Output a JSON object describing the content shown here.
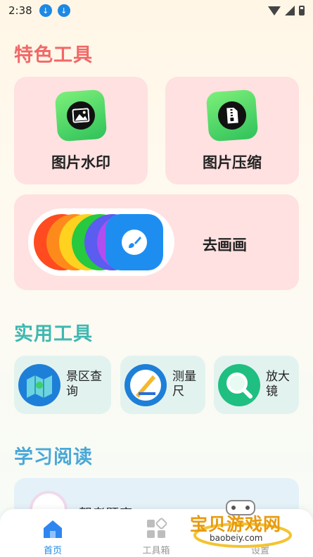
{
  "status_bar": {
    "time": "2:38"
  },
  "sections": {
    "featured": "特色工具",
    "practical": "实用工具",
    "study": "学习阅读"
  },
  "featured_tools": [
    {
      "label": "图片水印",
      "icon": "image-icon"
    },
    {
      "label": "图片压缩",
      "icon": "zip-file-icon"
    },
    {
      "label": "去画画",
      "icon": "paint-brush-icon"
    }
  ],
  "practical_tools": [
    {
      "label": "景区查询",
      "icon": "map-icon"
    },
    {
      "label": "测量尺",
      "icon": "ruler-icon"
    },
    {
      "label": "放大镜",
      "icon": "magnifier-icon"
    }
  ],
  "study_items": [
    {
      "label": "驾考题库",
      "icon": "book-icon"
    }
  ],
  "bottom_nav": [
    {
      "label": "首页",
      "icon": "home-icon",
      "active": true
    },
    {
      "label": "工具箱",
      "icon": "toolbox-icon",
      "active": false
    },
    {
      "label": "设置",
      "icon": "settings-icon",
      "active": false
    }
  ],
  "watermark": {
    "text": "宝贝游戏网",
    "url": "baobeiy.com"
  },
  "colors": {
    "featured_title": "#f06868",
    "practical_title": "#3fb8b0",
    "study_title": "#4aa8d8",
    "active_nav": "#1e88e5"
  }
}
